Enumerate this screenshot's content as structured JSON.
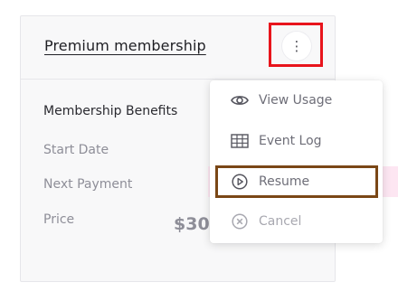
{
  "card": {
    "title": "Premium membership",
    "section_title": "Membership Benefits",
    "rows": [
      {
        "label": "Start Date"
      },
      {
        "label": "Next Payment"
      },
      {
        "label": "Price",
        "value": "$300"
      }
    ]
  },
  "menu": {
    "open_button_icon": "vertical-ellipsis-icon",
    "items": [
      {
        "label": "View Usage",
        "icon": "eye-icon",
        "state": "enabled"
      },
      {
        "label": "Event Log",
        "icon": "table-grid-icon",
        "state": "enabled"
      },
      {
        "label": "Resume",
        "icon": "play-circle-icon",
        "state": "highlighted"
      },
      {
        "label": "Cancel",
        "icon": "x-circle-icon",
        "state": "disabled"
      }
    ]
  },
  "colors": {
    "kebab_outline": "#e8141c",
    "resume_outline": "#7a4716",
    "resume_row_tint": "#fde6f2"
  }
}
